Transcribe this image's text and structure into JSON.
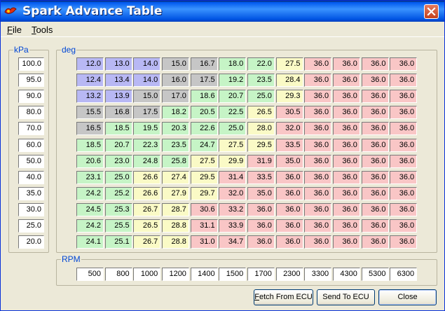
{
  "window": {
    "title": "Spark Advance Table"
  },
  "menu": [
    {
      "underline": "F",
      "rest": "ile"
    },
    {
      "underline": "T",
      "rest": "ools"
    }
  ],
  "kpa_group": {
    "label": "kPa",
    "values": [
      "100.0",
      "95.0",
      "90.0",
      "80.0",
      "70.0",
      "60.0",
      "50.0",
      "40.0",
      "35.0",
      "30.0",
      "25.0",
      "20.0"
    ]
  },
  "deg_group": {
    "label": "deg",
    "rows": [
      [
        "12.0",
        "13.0",
        "14.0",
        "15.0",
        "16.7",
        "18.0",
        "22.0",
        "27.5",
        "36.0",
        "36.0",
        "36.0",
        "36.0"
      ],
      [
        "12.4",
        "13.4",
        "14.0",
        "16.0",
        "17.5",
        "19.2",
        "23.5",
        "28.4",
        "36.0",
        "36.0",
        "36.0",
        "36.0"
      ],
      [
        "13.2",
        "13.9",
        "15.0",
        "17.0",
        "18.6",
        "20.7",
        "25.0",
        "29.3",
        "36.0",
        "36.0",
        "36.0",
        "36.0"
      ],
      [
        "15.5",
        "16.8",
        "17.5",
        "18.2",
        "20.5",
        "22.5",
        "26.5",
        "30.5",
        "36.0",
        "36.0",
        "36.0",
        "36.0"
      ],
      [
        "16.5",
        "18.5",
        "19.5",
        "20.3",
        "22.6",
        "25.0",
        "28.0",
        "32.0",
        "36.0",
        "36.0",
        "36.0",
        "36.0"
      ],
      [
        "18.5",
        "20.7",
        "22.3",
        "23.5",
        "24.7",
        "27.5",
        "29.5",
        "33.5",
        "36.0",
        "36.0",
        "36.0",
        "36.0"
      ],
      [
        "20.6",
        "23.0",
        "24.8",
        "25.8",
        "27.5",
        "29.9",
        "31.9",
        "35.0",
        "36.0",
        "36.0",
        "36.0",
        "36.0"
      ],
      [
        "23.1",
        "25.0",
        "26.6",
        "27.4",
        "29.5",
        "31.4",
        "33.5",
        "36.0",
        "36.0",
        "36.0",
        "36.0",
        "36.0"
      ],
      [
        "24.2",
        "25.2",
        "26.6",
        "27.9",
        "29.7",
        "32.0",
        "35.0",
        "36.0",
        "36.0",
        "36.0",
        "36.0",
        "36.0"
      ],
      [
        "24.5",
        "25.3",
        "26.7",
        "28.7",
        "30.6",
        "33.2",
        "36.0",
        "36.0",
        "36.0",
        "36.0",
        "36.0",
        "36.0"
      ],
      [
        "24.2",
        "25.5",
        "26.5",
        "28.8",
        "31.1",
        "33.9",
        "36.0",
        "36.0",
        "36.0",
        "36.0",
        "36.0",
        "36.0"
      ],
      [
        "24.1",
        "25.1",
        "26.7",
        "28.8",
        "31.0",
        "34.7",
        "36.0",
        "36.0",
        "36.0",
        "36.0",
        "36.0",
        "36.0"
      ]
    ],
    "colors": [
      [
        "blue",
        "blue",
        "blue",
        "gray",
        "gray",
        "green",
        "green",
        "yellow",
        "red",
        "red",
        "red",
        "red"
      ],
      [
        "blue",
        "blue",
        "blue",
        "gray",
        "gray",
        "green",
        "green",
        "yellow",
        "red",
        "red",
        "red",
        "red"
      ],
      [
        "blue",
        "blue",
        "gray",
        "gray",
        "green",
        "green",
        "green",
        "yellow",
        "red",
        "red",
        "red",
        "red"
      ],
      [
        "gray",
        "gray",
        "gray",
        "green",
        "green",
        "green",
        "yellow",
        "red",
        "red",
        "red",
        "red",
        "red"
      ],
      [
        "gray",
        "green",
        "green",
        "green",
        "green",
        "green",
        "yellow",
        "red",
        "red",
        "red",
        "red",
        "red"
      ],
      [
        "green",
        "green",
        "green",
        "green",
        "green",
        "yellow",
        "yellow",
        "red",
        "red",
        "red",
        "red",
        "red"
      ],
      [
        "green",
        "green",
        "green",
        "green",
        "yellow",
        "yellow",
        "red",
        "red",
        "red",
        "red",
        "red",
        "red"
      ],
      [
        "green",
        "green",
        "yellow",
        "yellow",
        "yellow",
        "red",
        "red",
        "red",
        "red",
        "red",
        "red",
        "red"
      ],
      [
        "green",
        "green",
        "yellow",
        "yellow",
        "yellow",
        "red",
        "red",
        "red",
        "red",
        "red",
        "red",
        "red"
      ],
      [
        "green",
        "green",
        "yellow",
        "yellow",
        "red",
        "red",
        "red",
        "red",
        "red",
        "red",
        "red",
        "red"
      ],
      [
        "green",
        "green",
        "yellow",
        "yellow",
        "red",
        "red",
        "red",
        "red",
        "red",
        "red",
        "red",
        "red"
      ],
      [
        "green",
        "green",
        "yellow",
        "yellow",
        "red",
        "red",
        "red",
        "red",
        "red",
        "red",
        "red",
        "red"
      ]
    ]
  },
  "rpm_group": {
    "label": "RPM",
    "values": [
      "500",
      "800",
      "1000",
      "1200",
      "1400",
      "1500",
      "1700",
      "2300",
      "3300",
      "4300",
      "5300",
      "6300"
    ]
  },
  "palette": {
    "blue": "#b8b8f4",
    "gray": "#c6c6c6",
    "green": "#c6f4c6",
    "yellow": "#fafac6",
    "red": "#f9c6c6"
  },
  "buttons": {
    "fetch": {
      "underline": "F",
      "rest": "etch From ECU"
    },
    "send": {
      "underline": "",
      "rest": "Send To ECU"
    },
    "close": {
      "underline": "",
      "rest": "Close"
    }
  },
  "icons": {
    "app": "spark-flame-icon",
    "close": "close-x-icon"
  }
}
